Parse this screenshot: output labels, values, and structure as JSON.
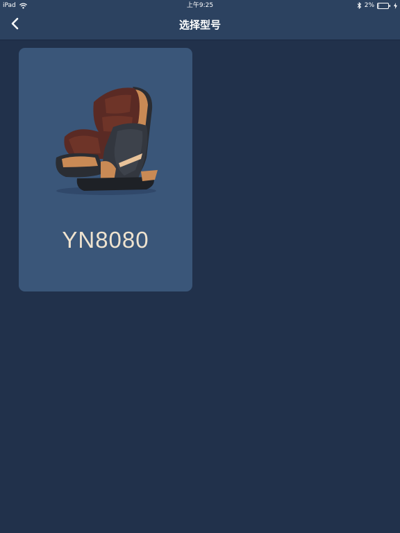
{
  "status_bar": {
    "device": "iPad",
    "time": "上午9:25",
    "battery_percent": "2%",
    "battery_level": 0.02,
    "icons": [
      "wifi-icon",
      "bluetooth-icon",
      "battery-icon",
      "charging-icon"
    ]
  },
  "nav": {
    "title": "选择型号",
    "back_icon": "chevron-left-icon"
  },
  "models": [
    {
      "name": "YN8080",
      "image": "massage-chair-image"
    }
  ],
  "colors": {
    "background": "#21314b",
    "bar": "#2c4260",
    "card": "#3a5679",
    "label": "#efe3cf",
    "chair_accent": "#c98a55",
    "chair_body": "#2a2d33",
    "chair_upholstery": "#5a2a24"
  }
}
